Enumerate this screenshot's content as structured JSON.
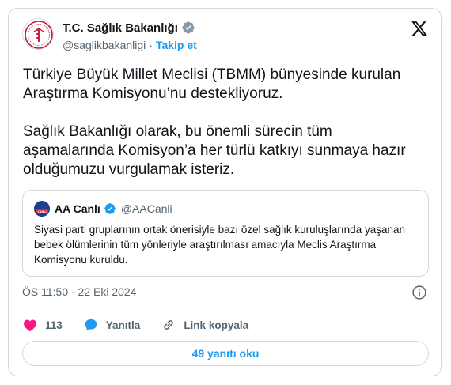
{
  "tweet": {
    "author_name": "T.C. Sağlık Bakanlığı",
    "author_handle": "@saglikbakanligi",
    "separator": "·",
    "follow_label": "Takip et",
    "text": "Türkiye Büyük Millet Meclisi (TBMM) bünyesinde kurulan Araştırma Komisyonu’nu destekliyoruz.\n\nSağlık Bakanlığı olarak, bu önemli sürecin tüm aşamalarında Komisyon’a her türlü katkıyı sunmaya hazır olduğumuzu vurgulamak isteriz.",
    "timestamp": "ÖS 11:50 · 22 Eki 2024"
  },
  "quote": {
    "author_name": "AA Canlı",
    "author_handle": "@AACanli",
    "avatar_text": "CANLI",
    "text": "Siyasi parti gruplarının ortak önerisiyle bazı özel sağlık kuruluşlarında yaşanan bebek ölümlerinin tüm yönleriyle araştırılması amacıyla Meclis Araştırma Komisyonu kuruldu."
  },
  "actions": {
    "like_count": "113",
    "reply_label": "Yanıtla",
    "copy_link_label": "Link kopyala"
  },
  "read_replies_label": "49 yanıtı oku",
  "icons": {
    "platform": "x-logo-icon",
    "verified": "verified-badge-icon",
    "info": "info-icon",
    "like": "heart-icon",
    "reply": "chat-bubble-icon",
    "link": "link-icon"
  },
  "colors": {
    "accent": "#1d9bf0",
    "like": "#f91880",
    "muted": "#536471",
    "text": "#0f1419",
    "border": "#cfd9de",
    "ministry_red": "#c8102e"
  }
}
